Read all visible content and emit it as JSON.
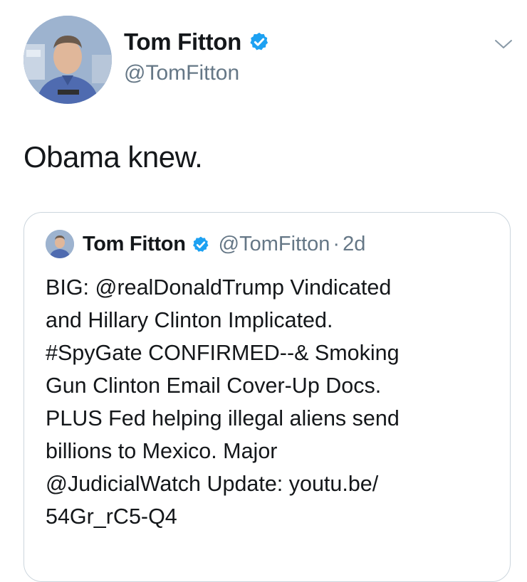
{
  "tweet": {
    "author": {
      "display_name": "Tom Fitton",
      "handle": "@TomFitton",
      "verified": true
    },
    "text": "Obama knew.",
    "menu_icon": "chevron-down-icon"
  },
  "quoted_tweet": {
    "author": {
      "display_name": "Tom Fitton",
      "handle": "@TomFitton",
      "verified": true
    },
    "separator": "·",
    "time": "2d",
    "lines": [
      "BIG: @realDonaldTrump Vindicated",
      "and Hillary Clinton Implicated.",
      "#SpyGate CONFIRMED--& Smoking",
      "Gun Clinton Email Cover-Up Docs.",
      "PLUS Fed helping illegal aliens send",
      "billions to Mexico. Major",
      "@JudicialWatch Update: youtu.be/",
      "54Gr_rC5-Q4"
    ]
  },
  "colors": {
    "verified_blue": "#1da1f2",
    "text": "#14171a",
    "secondary_text": "#657786",
    "card_border": "#ccd6dd"
  }
}
